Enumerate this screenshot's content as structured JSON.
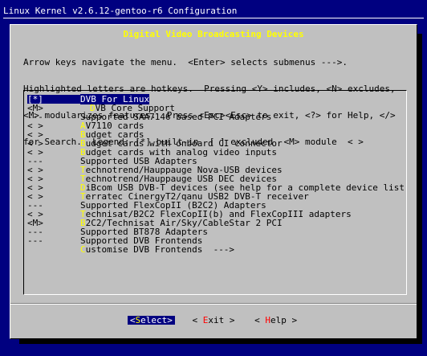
{
  "window": {
    "title": "Linux Kernel v2.6.12-gentoo-r6 Configuration"
  },
  "dialog": {
    "title": "Digital Video Broadcasting Devices",
    "help_lines": [
      "Arrow keys navigate the menu.  <Enter> selects submenus --->.",
      "Highlighted letters are hotkeys.  Pressing <Y> includes, <N> excludes,",
      "<M> modularizes features.  Press <Esc><Esc> to exit, <?> for Help, </>",
      "for Search.  Legend: [*] built-in  [ ] excluded  <M> module  < >"
    ]
  },
  "menu": {
    "items": [
      {
        "prefix": "[*]",
        "hotkey": "D",
        "rest": "VB For Linux",
        "selected": true
      },
      {
        "prefix": "<M>",
        "hotkey": "D",
        "rest": "VB Core Support",
        "indent": 1
      },
      {
        "prefix": "---",
        "hotkey": "",
        "rest": "Supported SAA7146 based PCI Adapters",
        "indent": 2
      },
      {
        "prefix": "< >",
        "hotkey": "A",
        "rest": "V7110 cards",
        "indent": 2
      },
      {
        "prefix": "< >",
        "hotkey": "B",
        "rest": "udget cards",
        "indent": 2
      },
      {
        "prefix": "< >",
        "hotkey": "B",
        "rest": "udget cards with onboard CI connector",
        "indent": 2
      },
      {
        "prefix": "< >",
        "hotkey": "B",
        "rest": "udget cards with analog video inputs",
        "indent": 2
      },
      {
        "prefix": "---",
        "hotkey": "",
        "rest": "Supported USB Adapters",
        "indent": 2
      },
      {
        "prefix": "< >",
        "hotkey": "T",
        "rest": "echnotrend/Hauppauge Nova-USB devices",
        "indent": 2
      },
      {
        "prefix": "< >",
        "hotkey": "T",
        "rest": "echnotrend/Hauppauge USB DEC devices",
        "indent": 2
      },
      {
        "prefix": "< >",
        "hotkey": "D",
        "rest": "iBcom USB DVB-T devices (see help for a complete device list",
        "indent": 2
      },
      {
        "prefix": "< >",
        "hotkey": "T",
        "rest": "erratec CinergyT2/qanu USB2 DVB-T receiver",
        "indent": 2
      },
      {
        "prefix": "---",
        "hotkey": "",
        "rest": "Supported FlexCopII (B2C2) Adapters",
        "indent": 2
      },
      {
        "prefix": "< >",
        "hotkey": "T",
        "rest": "echnisat/B2C2 FlexCopII(b) and FlexCopIII adapters",
        "indent": 2
      },
      {
        "prefix": "<M>",
        "hotkey": "B",
        "rest": "2C2/Technisat Air/Sky/CableStar 2 PCI",
        "indent": 2
      },
      {
        "prefix": "---",
        "hotkey": "",
        "rest": "Supported BT878 Adapters",
        "indent": 2
      },
      {
        "prefix": "---",
        "hotkey": "",
        "rest": "Supported DVB Frontends",
        "indent": 2
      },
      {
        "prefix": "",
        "hotkey": "C",
        "rest": "ustomise DVB Frontends  --->",
        "indent": 2
      }
    ]
  },
  "buttons": {
    "select": {
      "open": "<",
      "key": "S",
      "rest": "elect>"
    },
    "exit": {
      "open": "< ",
      "key": "E",
      "rest": "xit >"
    },
    "help": {
      "open": "< ",
      "key": "H",
      "rest": "elp >"
    }
  }
}
